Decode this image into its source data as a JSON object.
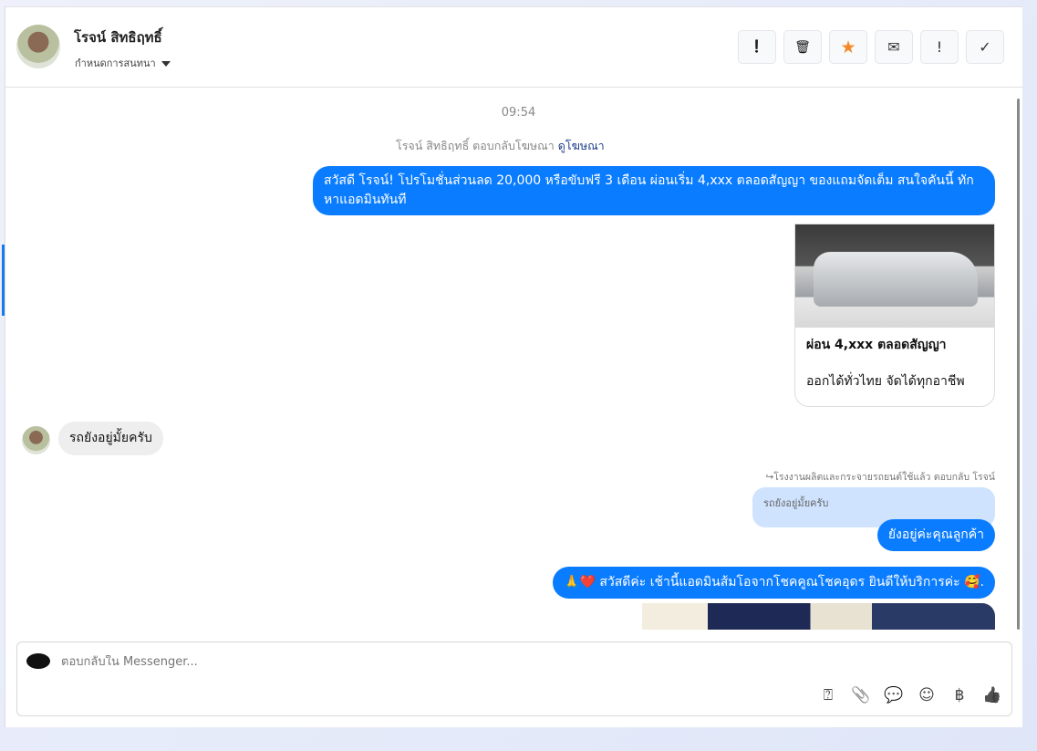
{
  "header": {
    "name": "โรจน์ สิทธิฤทธิ์",
    "subtitle": "กำหนดการสนทนา",
    "tools": [
      {
        "icon": "alert-circle-icon",
        "glyph": "❗"
      },
      {
        "icon": "trash-icon",
        "glyph": "🗑"
      },
      {
        "icon": "star-icon",
        "glyph": "★"
      },
      {
        "icon": "envelope-icon",
        "glyph": "✉"
      },
      {
        "icon": "exclamation-icon",
        "glyph": "!"
      },
      {
        "icon": "check-icon",
        "glyph": "✓"
      }
    ],
    "star_color": "#f5892a"
  },
  "messages": {
    "time": "09:54",
    "ad_reply": "โรจน์ สิทธิฤทธิ์ ตอบกลับโฆษณา",
    "ad_link": "ดูโฆษณา",
    "promo_text": "สวัสดี โรจน์! โปรโมชั่นส่วนลด 20,000 หรือขับฟรี 3 เดือน ผ่อนเริ่ม 4,xxx ตลอดสัญญา ของแถมจัดเต็ม สนใจคันนี้ ทักหาแอดมินทันที",
    "card_title": "ผ่อน 4,xxx ตลอดสัญญา",
    "card_desc": "ออกได้ทั่วไทย จัดได้ทุกอาชีพ",
    "incoming": "รถยังอยู่มั้ยครับ",
    "reply_label": "โรงงานผลิตและกระจายรถยนต์ใช้แล้ว ตอบกลับ โรจน์",
    "quoted": "รถยังอยู่มั้ยครับ",
    "reply": "ยังอยู่ค่ะคุณลูกค้า",
    "greeting": "🙏❤️ สวัสดีค่ะ เช้านี้แอดมินส้มโอจากโชคคูณโชคอุดร ยินดีให้บริการค่ะ 🥰."
  },
  "composer": {
    "placeholder": "ตอบกลับใน Messenger...",
    "icons": [
      {
        "icon": "saved-reply-icon",
        "glyph": "⍰"
      },
      {
        "icon": "paperclip-icon",
        "glyph": "📎"
      },
      {
        "icon": "chat-bubble-icon",
        "glyph": "💬"
      },
      {
        "icon": "emoji-icon",
        "glyph": "☺"
      },
      {
        "icon": "baht-icon",
        "glyph": "฿"
      },
      {
        "icon": "thumbs-up-icon",
        "glyph": "👍"
      }
    ]
  },
  "colors": {
    "accent": "#0a7cff",
    "quote_bg": "#cfe3ff"
  }
}
